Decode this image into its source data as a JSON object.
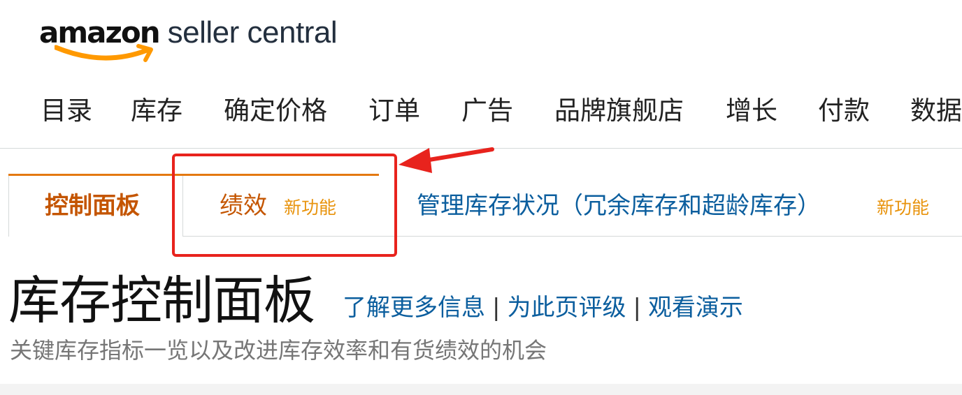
{
  "brand": {
    "amazon": "amazon",
    "product": "seller central",
    "accent_color": "#ff9900"
  },
  "top_nav": {
    "items": [
      {
        "label": "目录"
      },
      {
        "label": "库存"
      },
      {
        "label": "确定价格"
      },
      {
        "label": "订单"
      },
      {
        "label": "广告"
      },
      {
        "label": "品牌旗舰店"
      },
      {
        "label": "增长"
      },
      {
        "label": "付款"
      },
      {
        "label": "数据"
      }
    ]
  },
  "sub_tabs": {
    "active": {
      "label": "控制面板"
    },
    "performance": {
      "label": "绩效",
      "badge": "新功能"
    },
    "inventory_health": {
      "label": "管理库存状况（冗余库存和超龄库存）",
      "badge": "新功能"
    },
    "active_color": "#c45500",
    "link_color": "#0b5e9e",
    "badge_color": "#e8930c"
  },
  "annotation": {
    "highlight_color": "#e8231d",
    "icon": "arrow-left-icon"
  },
  "header": {
    "title": "库存控制面板",
    "links": {
      "learn_more": "了解更多信息",
      "rate_page": "为此页评级",
      "watch_demo": "观看演示",
      "separator": "|"
    },
    "subtitle": "关键库存指标一览以及改进库存效率和有货绩效的机会"
  }
}
